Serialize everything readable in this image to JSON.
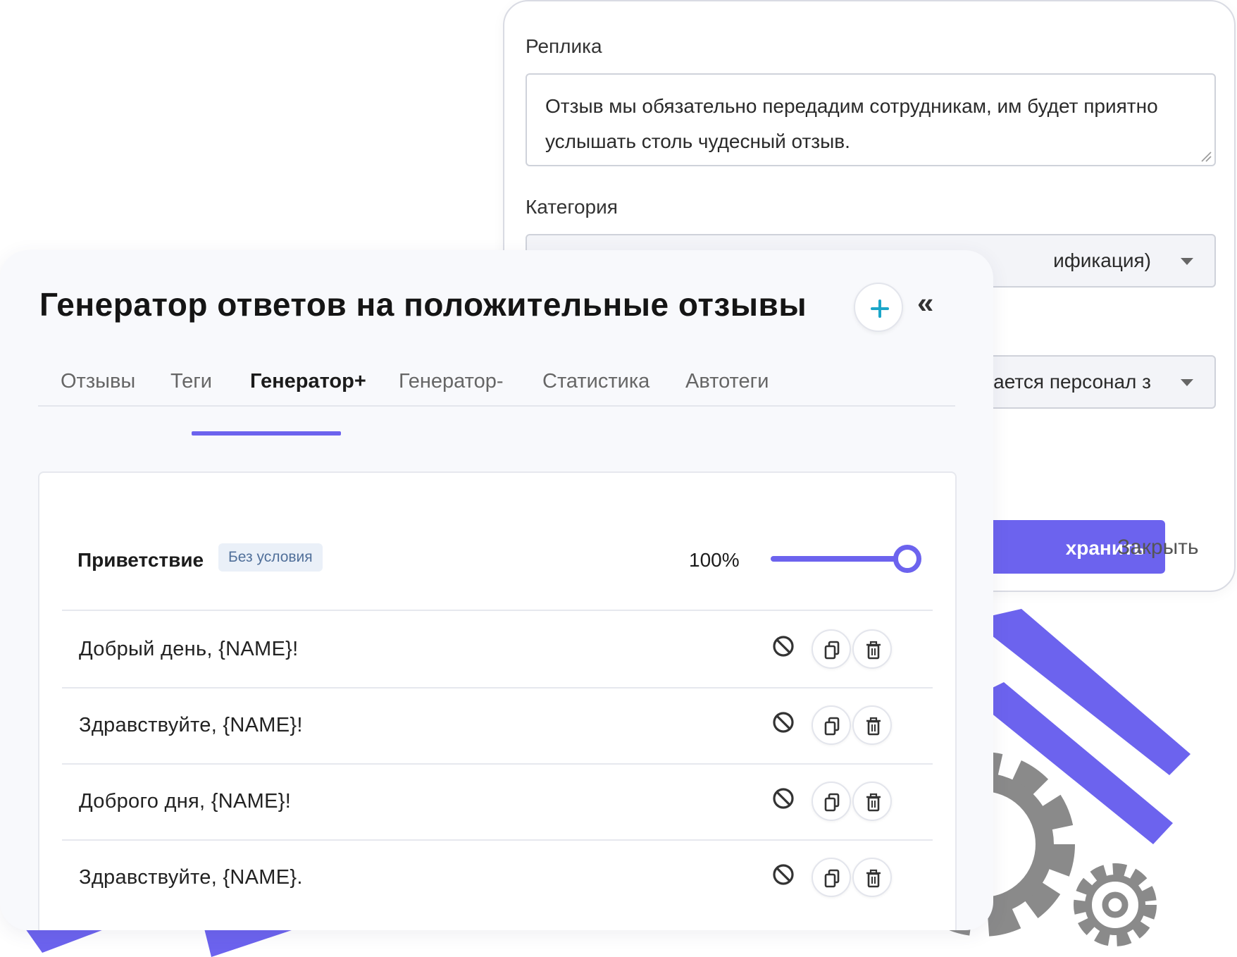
{
  "back_modal": {
    "replica_label": "Реплика",
    "replica_text": "Отзыв мы обязательно передадим сотрудникам, им будет приятно услышать столь чудесный отзыв.",
    "category_label": "Категория",
    "category_value": "ификация)",
    "second_select_value": "инается персонал з",
    "save_label": "хранить",
    "close_label": "Закрыть"
  },
  "header": {
    "title": "Генератор ответов на положительные отзывы",
    "collapse_label": "«"
  },
  "tabs": [
    {
      "label": "Отзывы"
    },
    {
      "label": "Теги"
    },
    {
      "label": "Генератор+"
    },
    {
      "label": "Генератор-"
    },
    {
      "label": "Статистика"
    },
    {
      "label": "Автотеги"
    }
  ],
  "active_tab": "Генератор+",
  "section": {
    "label": "Приветствие",
    "badge": "Без условия",
    "percent_text": "100%",
    "slider_value": 1.0
  },
  "phrases": [
    {
      "text": "Добрый день, {NAME}!"
    },
    {
      "text": "Здравствуйте, {NAME}!"
    },
    {
      "text": "Доброго дня, {NAME}!"
    },
    {
      "text": "Здравствуйте, {NAME}."
    }
  ],
  "icons": {
    "add": "plus-icon",
    "collapse": "double-chevron-left-icon",
    "disable": "ban-icon",
    "copy": "copy-icon",
    "delete": "trash-icon",
    "gear": "gear-icon"
  },
  "colors": {
    "accent": "#6c63ee",
    "plus": "#1ba6c9",
    "badge_bg": "#eaf0f8",
    "badge_text": "#51709a",
    "gear": "#8a8a8a"
  }
}
